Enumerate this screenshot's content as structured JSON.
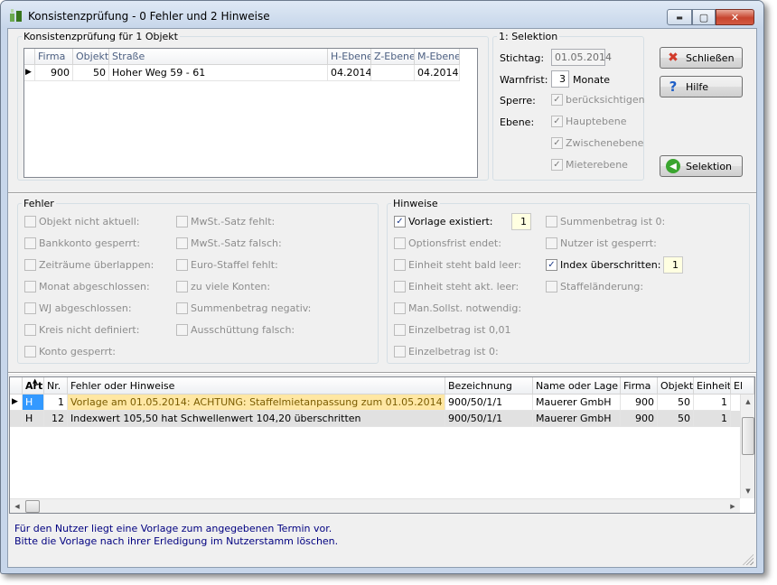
{
  "window": {
    "title": "Konsistenzprüfung - 0 Fehler und 2 Hinweise",
    "min": "▬",
    "max": "▢",
    "close": "✕"
  },
  "objekt_group": {
    "title": "Konsistenzprüfung für 1 Objekt",
    "columns": [
      "Firma",
      "Objekt",
      "Straße",
      "H-Ebene",
      "Z-Ebene",
      "M-Ebene"
    ],
    "rows": [
      {
        "indicator": "▶",
        "firma": "900",
        "objekt": "50",
        "strasse": "Hoher Weg 59 - 61",
        "h_ebene": "04.2014",
        "z_ebene": "",
        "m_ebene": "04.2014"
      }
    ]
  },
  "selektion": {
    "title": "1: Selektion",
    "stichtag_label": "Stichtag:",
    "stichtag_value": "01.05.2014",
    "warnfrist_label": "Warnfrist:",
    "warnfrist_value": "3",
    "warnfrist_unit": "Monate",
    "sperre_label": "Sperre:",
    "sperre_option": "berücksichtigen",
    "ebene_label": "Ebene:",
    "ebene_options": [
      "Hauptebene",
      "Zwischenebene",
      "Mieterebene"
    ]
  },
  "buttons": {
    "schliessen": "Schließen",
    "hilfe": "Hilfe",
    "selektion": "Selektion"
  },
  "fehler": {
    "title": "Fehler",
    "col1": [
      "Objekt nicht aktuell:",
      "Bankkonto gesperrt:",
      "Zeiträume überlappen:",
      "Monat abgeschlossen:",
      "WJ abgeschlossen:",
      "Kreis nicht definiert:",
      "Konto gesperrt:"
    ],
    "col2": [
      "MwSt.-Satz fehlt:",
      "MwSt.-Satz falsch:",
      "Euro-Staffel fehlt:",
      "zu viele Konten:",
      "Summenbetrag negativ:",
      "Ausschüttung falsch:"
    ]
  },
  "hinweise": {
    "title": "Hinweise",
    "col1": [
      "Vorlage existiert:",
      "Optionsfrist endet:",
      "Einheit steht bald leer:",
      "Einheit steht akt. leer:",
      "Man.Sollst. notwendig:",
      "Einzelbetrag ist 0,01",
      "Einzelbetrag ist 0:"
    ],
    "col2": [
      "Summenbetrag ist 0:",
      "Nutzer ist gesperrt:",
      "Index überschritten:",
      "Staffeländerung:"
    ],
    "vorlage_count": "1",
    "index_count": "1"
  },
  "results": {
    "columns": [
      "Art",
      "Nr.",
      "Fehler oder Hinweise",
      "Bezeichnung",
      "Name oder Lage",
      "Firma",
      "Objekt",
      "Einheit",
      "El"
    ],
    "rows": [
      {
        "indicator": "▶",
        "art": "H",
        "nr": "1",
        "text": "Vorlage am 01.05.2014: ACHTUNG: Staffelmietanpassung zum 01.05.2014",
        "bezeichnung": "900/50/1/1",
        "name": "Mauerer GmbH",
        "firma": "900",
        "objekt": "50",
        "einheit": "1"
      },
      {
        "indicator": "",
        "art": "H",
        "nr": "12",
        "text": "Indexwert 105,50 hat Schwellenwert 104,20 überschritten",
        "bezeichnung": "900/50/1/1",
        "name": "Mauerer GmbH",
        "firma": "900",
        "objekt": "50",
        "einheit": "1"
      }
    ]
  },
  "info": {
    "line1": "Für den Nutzer liegt eine Vorlage zum angegebenen Termin vor.",
    "line2": "Bitte die Vorlage nach ihrer Erledigung im Nutzerstamm löschen."
  },
  "colors": {
    "highlight_row": "#ffe7a3",
    "info_text": "#000080",
    "selected_cell": "#3399ff"
  }
}
